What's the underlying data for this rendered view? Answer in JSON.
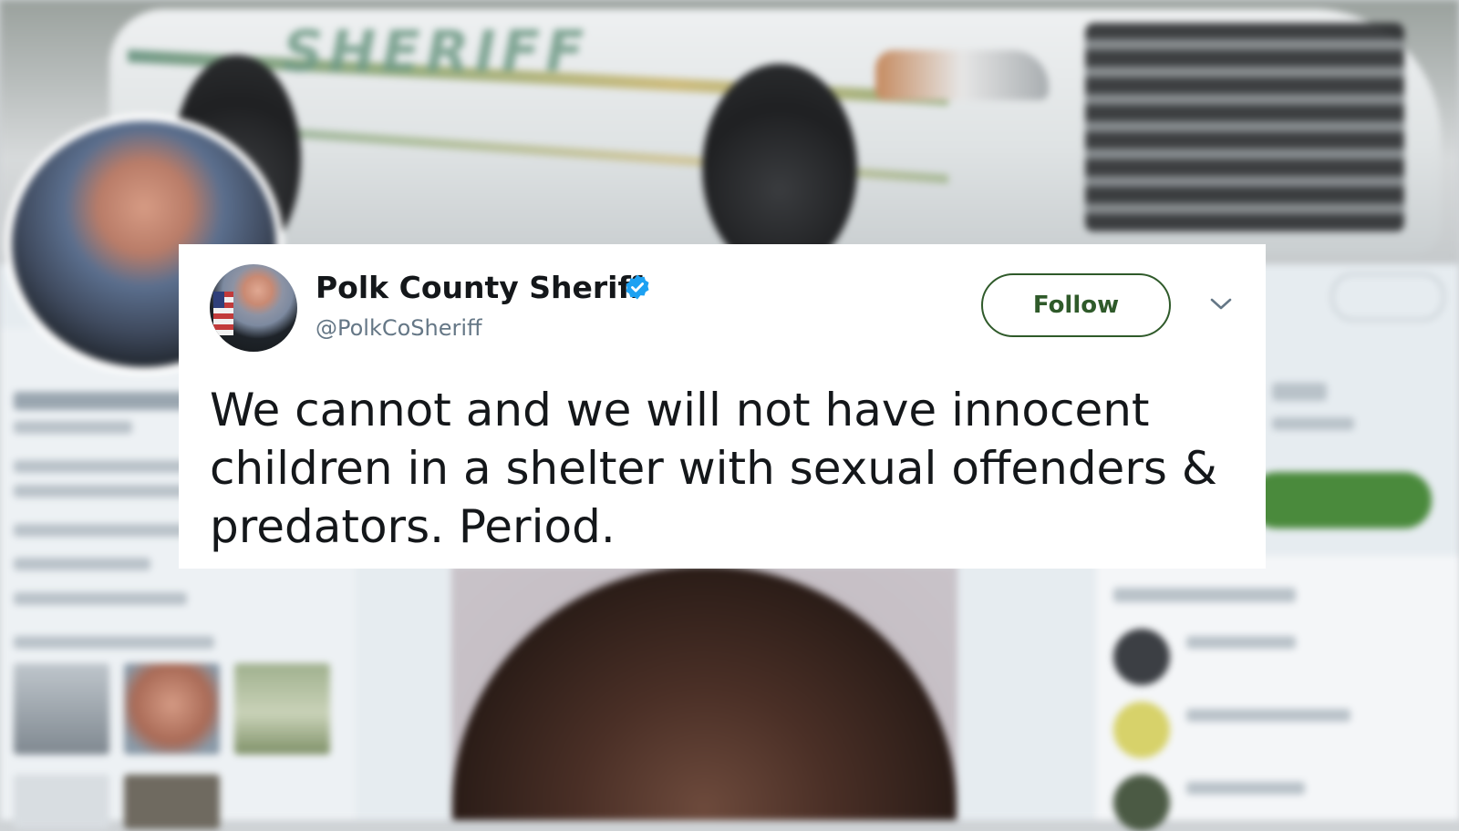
{
  "background": {
    "banner_text": "SHERIFF"
  },
  "tweet": {
    "author_name": "Polk County Sheriff",
    "author_handle": "@PolkCoSheriff",
    "verified_icon": "verified-badge-icon",
    "follow_label": "Follow",
    "menu_icon": "chevron-down-icon",
    "text": "We cannot and we will not have innocent children in a shelter with sexual offenders & predators. Period."
  },
  "colors": {
    "follow_accent": "#2f5a2a",
    "verified_blue": "#1da1f2",
    "text_primary": "#14171a",
    "text_secondary": "#657786"
  }
}
